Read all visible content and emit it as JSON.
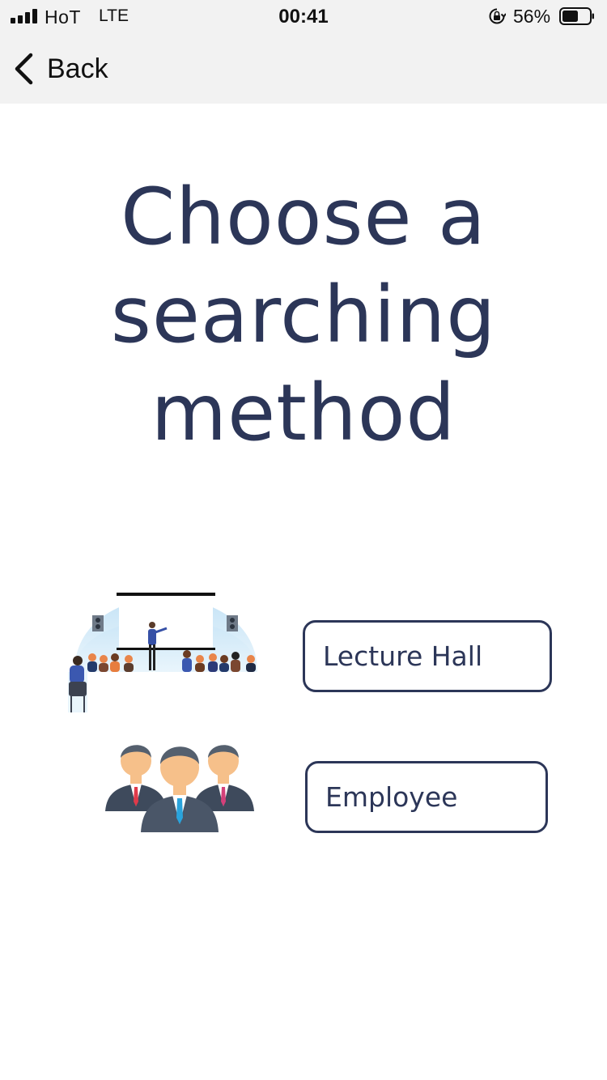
{
  "status_bar": {
    "carrier": "HoT",
    "network": "LTE",
    "time": "00:41",
    "battery_percent": "56%",
    "icons": [
      "signal-icon",
      "orientation-lock-icon",
      "battery-icon"
    ]
  },
  "nav": {
    "back_label": "Back",
    "back_icon": "chevron-left-icon"
  },
  "title": {
    "lines": [
      "Choose a",
      "searching",
      "method"
    ]
  },
  "options": [
    {
      "label": "Lecture Hall",
      "icon": "lecture-hall-illustration"
    },
    {
      "label": "Employee",
      "icon": "employees-illustration"
    }
  ],
  "colors": {
    "primary": "#2c3658",
    "bar_background": "#f2f2f2",
    "background": "#ffffff"
  }
}
